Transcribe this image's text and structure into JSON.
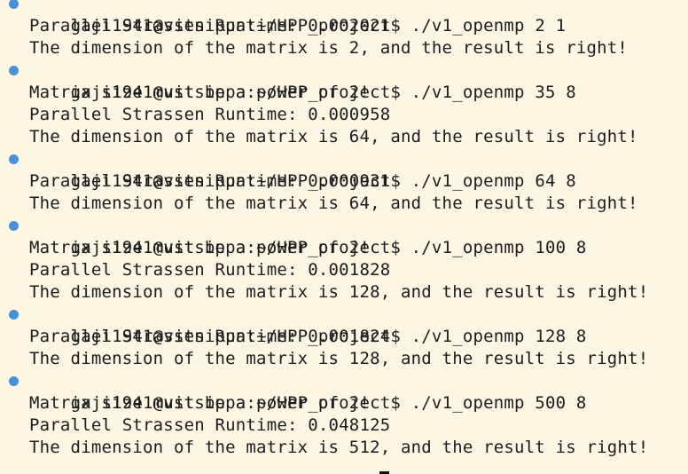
{
  "terminal": {
    "prompt": "gaji1941@vitsippa:~/HPP_project$",
    "commands": [
      {
        "command": "./v1_openmp 2 1",
        "output": [
          "Parallel Strassen Runtime: 0.002021",
          "The dimension of the matrix is 2, and the result is right!"
        ]
      },
      {
        "command": "./v1_openmp 35 8",
        "output": [
          "Matrix size must be a power of 2!",
          "Parallel Strassen Runtime: 0.000958",
          "The dimension of the matrix is 64, and the result is right!"
        ]
      },
      {
        "command": "./v1_openmp 64 8",
        "output": [
          "Parallel Strassen Runtime: 0.000931",
          "The dimension of the matrix is 64, and the result is right!"
        ]
      },
      {
        "command": "./v1_openmp 100 8",
        "output": [
          "Matrix size must be a power of 2!",
          "Parallel Strassen Runtime: 0.001828",
          "The dimension of the matrix is 128, and the result is right!"
        ]
      },
      {
        "command": "./v1_openmp 128 8",
        "output": [
          "Parallel Strassen Runtime: 0.001824",
          "The dimension of the matrix is 128, and the result is right!"
        ]
      },
      {
        "command": "./v1_openmp 500 8",
        "output": [
          "Matrix size must be a power of 2!",
          "Parallel Strassen Runtime: 0.048125",
          "The dimension of the matrix is 512, and the result is right!"
        ]
      }
    ]
  },
  "colors": {
    "background": "#fdf6e3",
    "text": "#1c1c1c",
    "status_dot": "#4a90d9"
  }
}
